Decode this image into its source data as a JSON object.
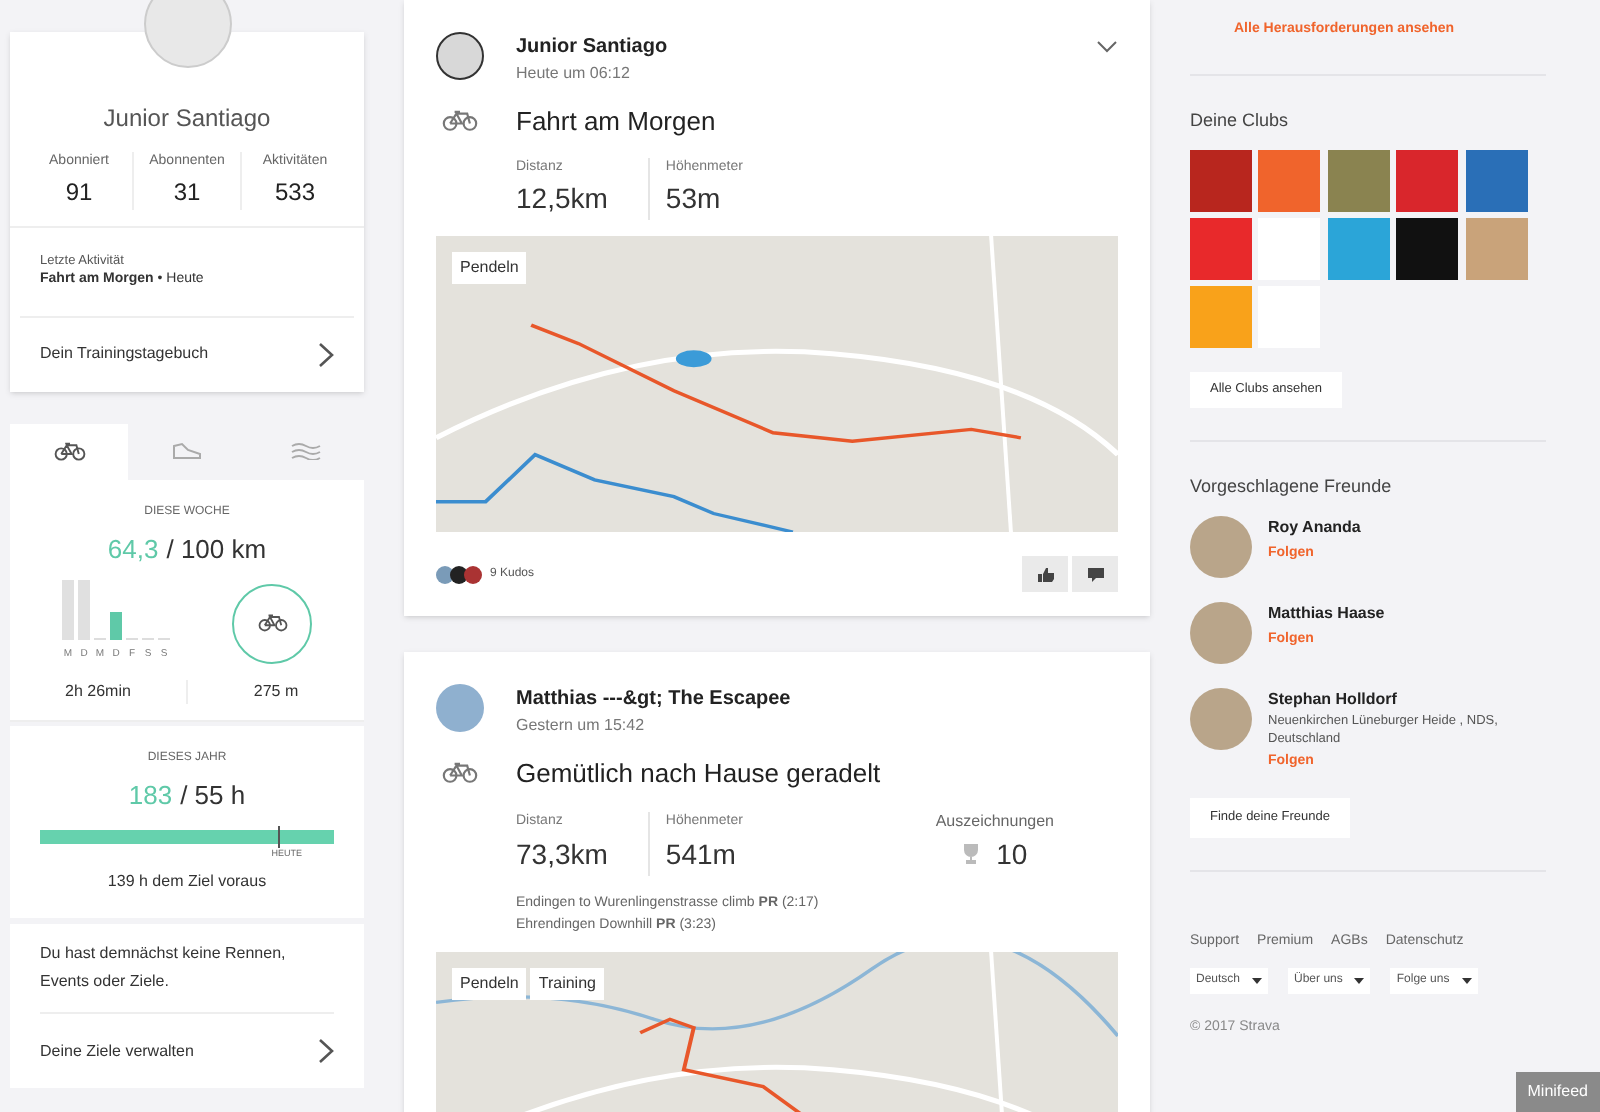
{
  "profile": {
    "name": "Junior Santiago",
    "stats": [
      {
        "label": "Abonniert",
        "value": "91"
      },
      {
        "label": "Abonnenten",
        "value": "31"
      },
      {
        "label": "Aktivitäten",
        "value": "533"
      }
    ],
    "last_activity_label": "Letzte Aktivität",
    "last_activity": "**Fahrt am Morgen** • Heute",
    "diary_link": "Dein Trainingstagebuch"
  },
  "sport_tabs": [
    {
      "kind": "bike",
      "selected": true
    },
    {
      "kind": "run",
      "selected": false
    },
    {
      "kind": "swim",
      "selected": false
    }
  ],
  "week": {
    "title": "DIESE WOCHE",
    "done": "64,3",
    "goal": "/ 100 km",
    "days": [
      "M",
      "D",
      "M",
      "D",
      "F",
      "S",
      "S"
    ],
    "time": "2h 26min",
    "elevation": "275 m"
  },
  "year": {
    "title": "DIESES JAHR",
    "done": "183",
    "goal": "/ 55 h",
    "level": 1,
    "today_label": "HEUTE",
    "note": "139 h dem Ziel voraus"
  },
  "goals": {
    "text": "Du hast demnächst keine Rennen, Events oder Ziele.",
    "link": "Deine Ziele verwalten"
  },
  "feed": [
    {
      "athlete": "Junior Santiago",
      "time": "Heute um 06:12",
      "title": "Fahrt am Morgen",
      "stats": [
        {
          "label": "Distanz",
          "value": "12,5km"
        },
        {
          "label": "Höhenmeter",
          "value": "53m"
        }
      ],
      "tags": [
        "Pendeln"
      ],
      "kudos": "9 Kudos",
      "menu": true
    },
    {
      "athlete": "Matthias ---&gt; The Escapee",
      "time": "Gestern um 15:42",
      "title": "Gemütlich nach Hause geradelt",
      "stats": [
        {
          "label": "Distanz",
          "value": "73,3km"
        },
        {
          "label": "Höhenmeter",
          "value": "541m"
        }
      ],
      "achievements_label": "Auszeichnungen",
      "achievements": "10",
      "segments": [
        "Endingen to Wurenlingenstrasse climb **PR** (2:17)",
        "Ehrendingen Downhill **PR** (3:23)"
      ],
      "tags": [
        "Pendeln",
        "Training"
      ],
      "menu": false
    }
  ],
  "challenges_link": "Alle Herausforderungen ansehen",
  "clubs": {
    "title": "Deine Clubs",
    "items": [
      {
        "color": "#b8261e"
      },
      {
        "color": "#f0642c"
      },
      {
        "color": "#8a8350"
      },
      {
        "color": "#d9262c"
      },
      {
        "color": "#2a6fb7"
      },
      {
        "color": "#e8292b"
      },
      {
        "color": "#ffffff"
      },
      {
        "color": "#2ba5d8"
      },
      {
        "color": "#111111"
      },
      {
        "color": "#c9a37a"
      },
      {
        "color": "#f9a21a"
      },
      {
        "color": "#ffffff"
      }
    ],
    "button": "Alle Clubs ansehen"
  },
  "friends": {
    "title": "Vorgeschlagene Freunde",
    "items": [
      {
        "name": "Roy Ananda",
        "follow": "Folgen"
      },
      {
        "name": "Matthias Haase",
        "follow": "Folgen"
      },
      {
        "name": "Stephan Holldorf",
        "location": "Neuenkirchen Lüneburger Heide , NDS, Deutschland",
        "follow": "Folgen"
      }
    ],
    "button": "Finde deine Freunde"
  },
  "footer": {
    "links": [
      "Support",
      "Premium",
      "AGBs",
      "Datenschutz"
    ],
    "dropdowns": [
      "Deutsch",
      "Über uns",
      "Folge uns"
    ],
    "copyright": "© 2017 Strava"
  },
  "minifeed": "Minifeed"
}
